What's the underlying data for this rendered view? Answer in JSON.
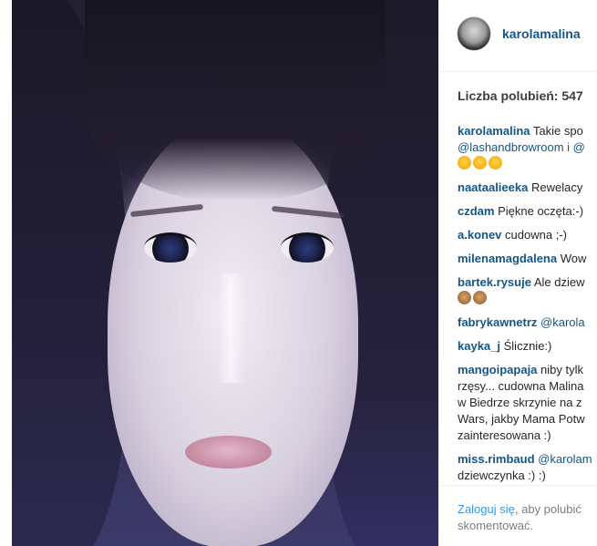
{
  "post": {
    "username": "karolamalina",
    "likes_text": "Liczba polubień: 547"
  },
  "comments": [
    {
      "user": "karolamalina",
      "lines": [
        "Takie spo"
      ],
      "mention_line": "@lashandbrowroom i @",
      "emoji_count": 3
    },
    {
      "user": "naataalieeka",
      "lines": [
        "Rewelacy"
      ]
    },
    {
      "user": "czdam",
      "lines": [
        "Piękne oczęta:-)"
      ]
    },
    {
      "user": "a.konev",
      "lines": [
        "cudowna ;-)"
      ]
    },
    {
      "user": "milenamagdalena",
      "lines": [
        "Wow"
      ]
    },
    {
      "user": "bartek.rysuje",
      "lines": [
        "Ale dziew"
      ],
      "emoji_count": 2
    },
    {
      "user": "fabrykawnetrz",
      "mention_first": "@karola"
    },
    {
      "user": "kayka_j",
      "lines": [
        "Ślicznie:)"
      ]
    },
    {
      "user": "mangoipapaja",
      "lines": [
        "niby tylk"
      ],
      "more_lines": [
        "rzęsy... cudowna Malina",
        "w Biedrze skrzynie na z",
        "Wars, jakby Mama Potw",
        "zainteresowana :)"
      ]
    },
    {
      "user": "miss.rimbaud",
      "mention_first": "@karolam",
      "more_lines": [
        "dziewczynka :) :)"
      ]
    }
  ],
  "footer": {
    "login_link": "Zaloguj się",
    "rest_line1": ", aby polubić",
    "line2": "skomentować."
  },
  "colors": {
    "link": "#125688",
    "login": "#3897f0"
  }
}
